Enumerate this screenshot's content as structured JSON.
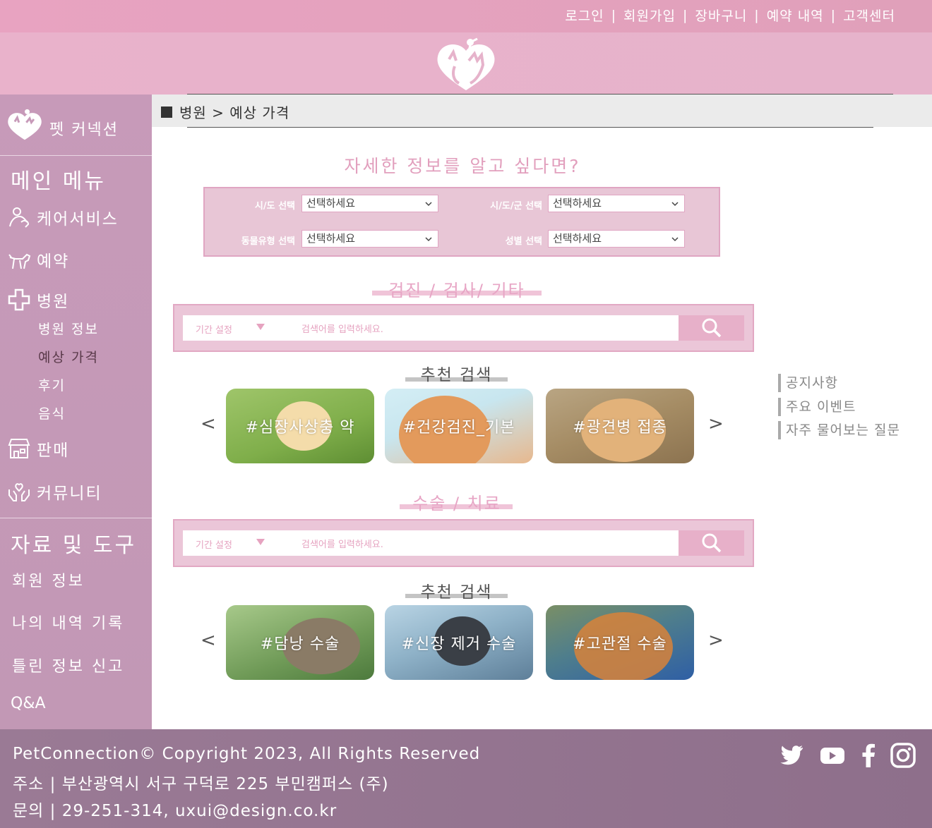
{
  "top_nav": {
    "items": [
      "로그인",
      "회원가입",
      "장바구니",
      "예약 내역",
      "고객센터"
    ],
    "separator": "|"
  },
  "sidebar": {
    "brand": "펫 커넥션",
    "main_menu_title": "메인 메뉴",
    "menu": [
      {
        "label": "케어서비스",
        "icon": "care-icon"
      },
      {
        "label": "예약",
        "icon": "dog-icon"
      },
      {
        "label": "병원",
        "icon": "cross-icon"
      },
      {
        "label": "판매",
        "icon": "store-icon"
      },
      {
        "label": "커뮤니티",
        "icon": "hands-icon"
      }
    ],
    "hospital_sub": [
      "병원 정보",
      "예상 가격",
      "후기",
      "음식"
    ],
    "tools_title": "자료 및 도구",
    "tools": [
      "회원 정보",
      "나의 내역 기록",
      "틀린 정보 신고",
      "Q&A"
    ]
  },
  "breadcrumb": "병원 > 예상 가격",
  "main": {
    "title": "자세한 정보를 알고 싶다면?",
    "filters": [
      {
        "label": "시/도 선택",
        "value": "선택하세요"
      },
      {
        "label": "시/도/군 선택",
        "value": "선택하세요"
      },
      {
        "label": "동물유형 선택",
        "value": "선택하세요"
      },
      {
        "label": "성별 선택",
        "value": "선택하세요"
      }
    ],
    "sections": [
      {
        "title": "검진 / 검사/ 기타",
        "period_label": "기간 설정",
        "search_placeholder": "검색어를 입력하세요.",
        "rec_title": "추천 검색",
        "cards": [
          "#심장사상충 약",
          "#건강검진_기본",
          "#광견병 접종"
        ]
      },
      {
        "title": "수술 / 치료",
        "period_label": "기간 설정",
        "search_placeholder": "검색어를 입력하세요.",
        "rec_title": "추천 검색",
        "cards": [
          "#담낭 수술",
          "#신장 제거 수술",
          "#고관절 수술"
        ]
      }
    ],
    "prev_arrow": "<",
    "next_arrow": ">"
  },
  "right_links": [
    "공지사항",
    "주요 이벤트",
    "자주 물어보는 질문"
  ],
  "footer": {
    "copyright": "PetConnection© Copyright 2023, All Rights Reserved",
    "address": "주소 | 부산광역시 서구 구덕로 225 부민캠퍼스 (주)",
    "contact": "문의 | 29-251-314, uxui@design.co.kr",
    "social": [
      "twitter-icon",
      "youtube-icon",
      "facebook-icon",
      "instagram-icon"
    ]
  },
  "colors": {
    "pink_primary": "#e8a3c1",
    "sidebar": "#c79ab9",
    "footer": "#8e6f8b",
    "accent_text": "#e29fbd"
  }
}
